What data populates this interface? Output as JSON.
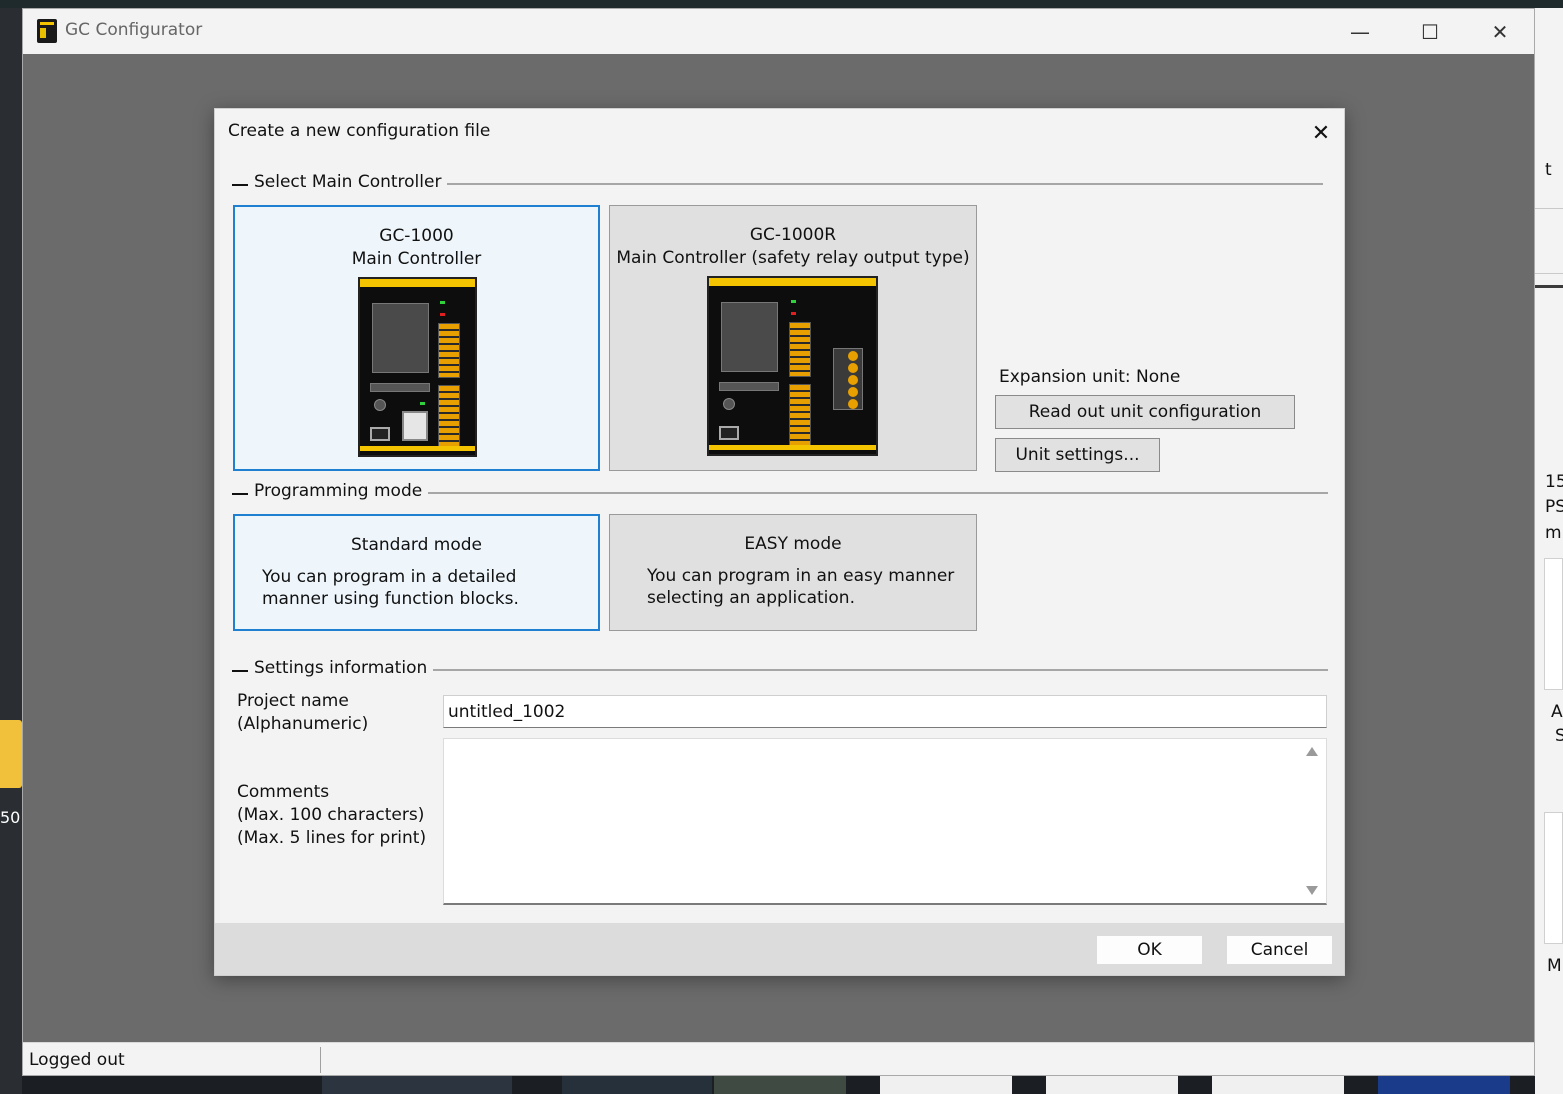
{
  "window": {
    "title": "GC Configurator",
    "minimize_glyph": "—",
    "maximize_glyph": "☐",
    "close_glyph": "✕"
  },
  "status_bar": {
    "login_status": "Logged out"
  },
  "dialog": {
    "title": "Create a new configuration file",
    "close_glyph": "✕",
    "main_controller": {
      "group_label": "Select Main Controller",
      "options": [
        {
          "name": "GC-1000",
          "subtitle": "Main Controller",
          "selected": true
        },
        {
          "name": "GC-1000R",
          "subtitle": "Main Controller (safety relay output type)",
          "selected": false
        }
      ],
      "expansion_unit": "Expansion unit: None",
      "read_out_button": "Read out unit configuration",
      "unit_settings_button": "Unit settings..."
    },
    "programming_mode": {
      "group_label": "Programming mode",
      "options": [
        {
          "name": "Standard mode",
          "description": "You can program in a detailed manner using function blocks.",
          "selected": true
        },
        {
          "name": "EASY mode",
          "description": "You can program in an easy manner selecting an application.",
          "selected": false
        }
      ]
    },
    "settings": {
      "group_label": "Settings information",
      "project_name_label_1": "Project name",
      "project_name_label_2": "(Alphanumeric)",
      "project_name_value": "untitled_1002",
      "comments_label_1": "Comments",
      "comments_label_2": "(Max. 100 characters)",
      "comments_label_3": "(Max. 5 lines for print)",
      "comments_value": ""
    },
    "ok_button": "OK",
    "cancel_button": "Cancel"
  },
  "desktop": {
    "right_fragments": [
      "t",
      "15",
      "PS",
      "m",
      "A",
      "S",
      "M"
    ],
    "left_fragment": "50"
  },
  "colors": {
    "selection_border": "#1f7fd1",
    "selection_fill": "#eef6fc",
    "controller_yellow": "#f5c400",
    "terminal_orange": "#e8a000"
  }
}
